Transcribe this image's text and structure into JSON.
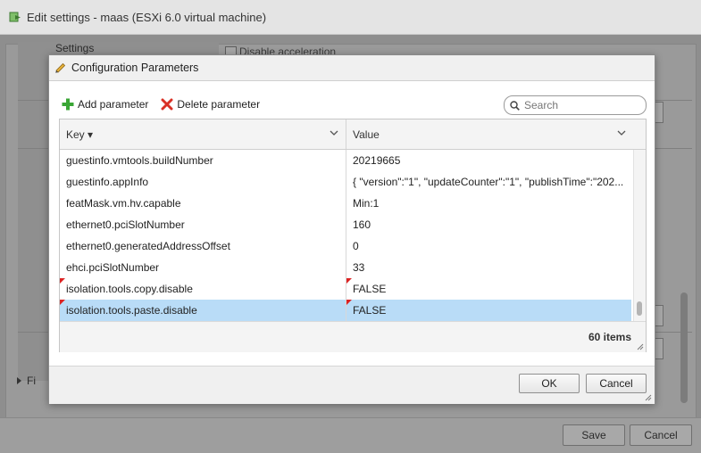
{
  "background_window": {
    "title": "Edit settings - maas (ESXi 6.0 virtual machine)",
    "left_label": "Settings",
    "checkbox_label": "Disable acceleration",
    "collapsed_label": "Fi",
    "save_label": "Save",
    "cancel_label": "Cancel"
  },
  "dialog": {
    "title": "Configuration Parameters",
    "toolbar": {
      "add_label": "Add parameter",
      "delete_label": "Delete parameter"
    },
    "search": {
      "placeholder": "Search",
      "value": ""
    },
    "table": {
      "columns": [
        "Key ▾",
        "Value"
      ],
      "rows": [
        {
          "key": "guestinfo.vmtools.buildNumber",
          "value": "20219665",
          "key_flag": false,
          "value_flag": false,
          "selected": false
        },
        {
          "key": "guestinfo.appInfo",
          "value": "{ \"version\":\"1\", \"updateCounter\":\"1\", \"publishTime\":\"202...",
          "key_flag": false,
          "value_flag": false,
          "selected": false
        },
        {
          "key": "featMask.vm.hv.capable",
          "value": "Min:1",
          "key_flag": false,
          "value_flag": false,
          "selected": false
        },
        {
          "key": "ethernet0.pciSlotNumber",
          "value": "160",
          "key_flag": false,
          "value_flag": false,
          "selected": false
        },
        {
          "key": "ethernet0.generatedAddressOffset",
          "value": "0",
          "key_flag": false,
          "value_flag": false,
          "selected": false
        },
        {
          "key": "ehci.pciSlotNumber",
          "value": "33",
          "key_flag": false,
          "value_flag": false,
          "selected": false
        },
        {
          "key": "isolation.tools.copy.disable",
          "value": "FALSE",
          "key_flag": true,
          "value_flag": true,
          "selected": false
        },
        {
          "key": "isolation.tools.paste.disable",
          "value": "FALSE",
          "key_flag": true,
          "value_flag": true,
          "selected": true
        }
      ],
      "item_count": "60 items"
    },
    "ok_label": "OK",
    "cancel_label": "Cancel"
  },
  "colors": {
    "selection": "#b9dcf7",
    "modified_flag": "#dd2222",
    "add_icon": "#3aa635",
    "delete_icon": "#d93025"
  },
  "icons": [
    "vm-settings-icon",
    "pencil-icon",
    "add-icon",
    "delete-icon",
    "search-icon",
    "sort-chevron-icon",
    "resize-grip-icon"
  ]
}
